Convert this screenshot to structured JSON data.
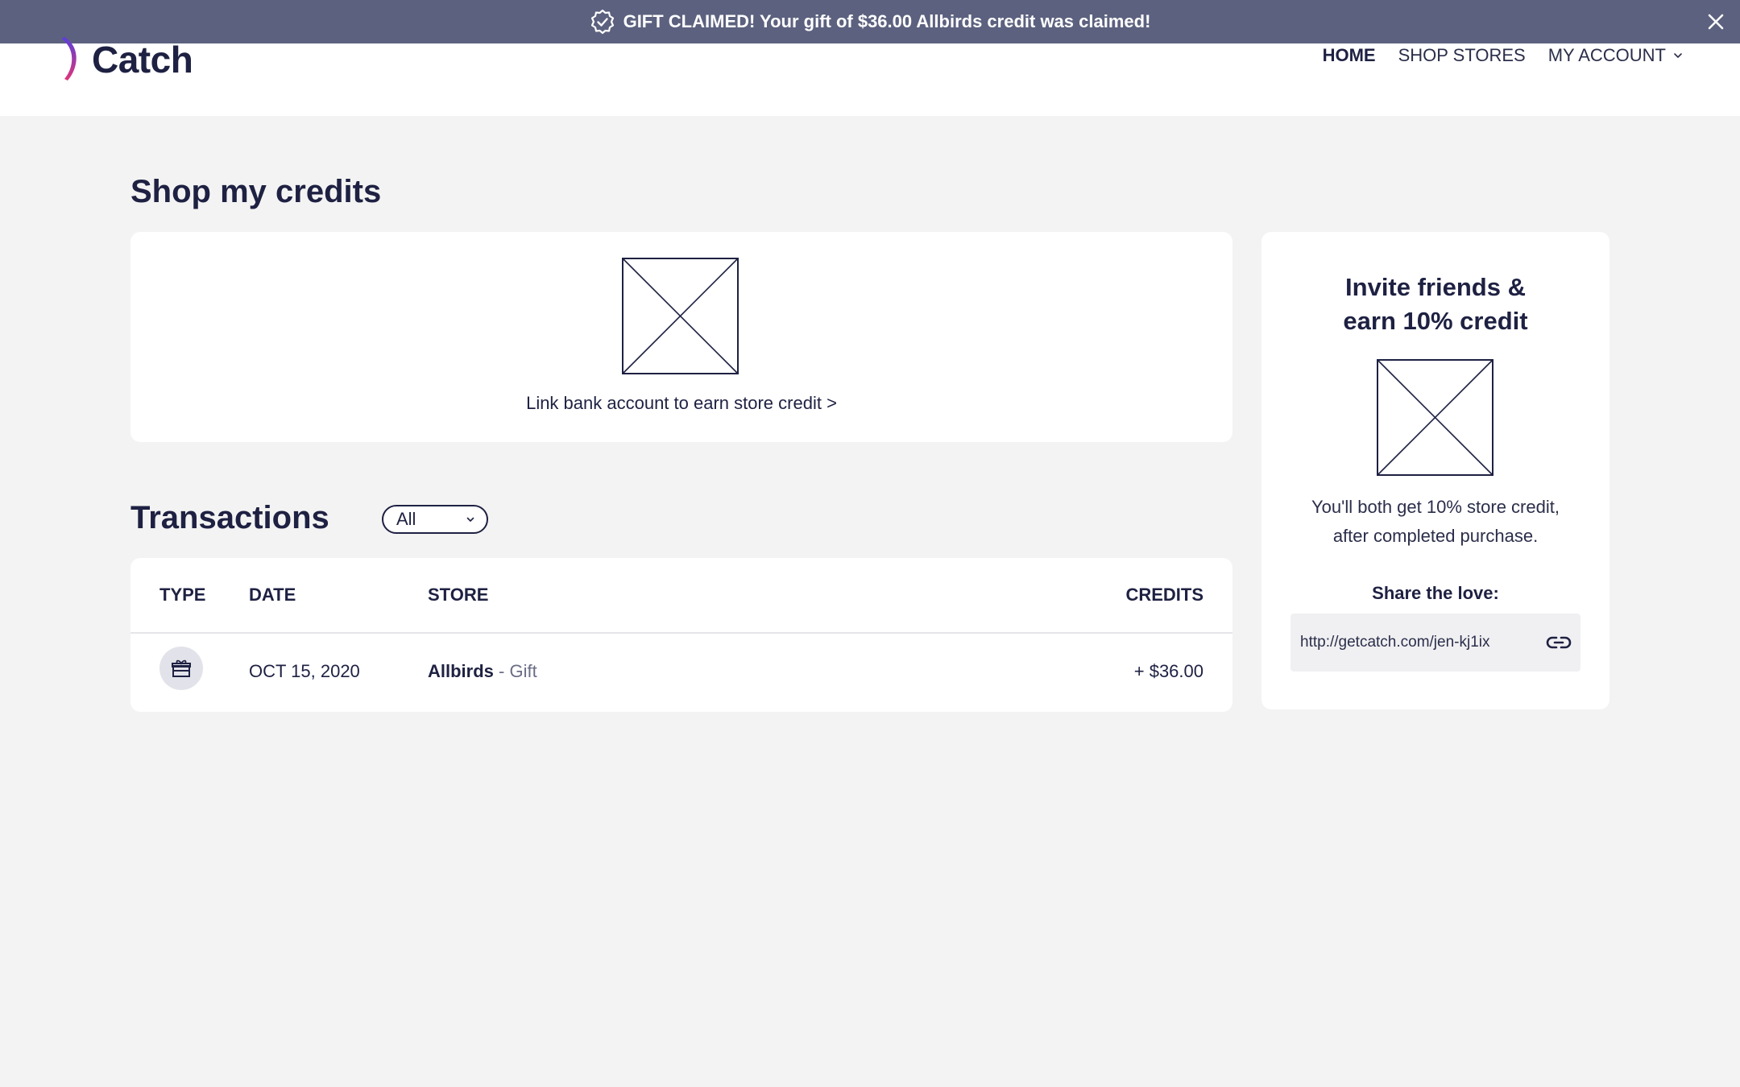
{
  "banner": {
    "message": "GIFT CLAIMED! Your gift of $36.00 Allbirds credit was claimed!",
    "icon": "badge-check-icon",
    "close_icon": "close-icon"
  },
  "header": {
    "logo_text": "Catch",
    "nav": {
      "home": "HOME",
      "shop_stores": "SHOP STORES",
      "my_account": "MY ACCOUNT"
    }
  },
  "main": {
    "page_title": "Shop my credits",
    "bank_card": {
      "link_text": "Link bank account to earn store credit >"
    },
    "transactions": {
      "title": "Transactions",
      "filter_value": "All",
      "columns": {
        "type": "TYPE",
        "date": "DATE",
        "store": "STORE",
        "credits": "CREDITS"
      },
      "rows": [
        {
          "type_icon": "gift-icon",
          "date": "OCT 15, 2020",
          "store": "Allbirds",
          "store_type": " - Gift",
          "credits": "+ $36.00"
        }
      ]
    }
  },
  "invite": {
    "title_line1": "Invite friends &",
    "title_line2": "earn 10% credit",
    "desc_line1": "You'll both get 10% store credit,",
    "desc_line2": "after completed purchase.",
    "share_label": "Share the love:",
    "share_url": "http://getcatch.com/jen-kj1ix",
    "link_icon": "link-icon"
  },
  "colors": {
    "banner_bg": "#5c617f",
    "page_bg": "#f3f3f3",
    "text_dark": "#1e2142",
    "logo_gradient_start": "#e0357a",
    "logo_gradient_end": "#5a3fd9"
  }
}
